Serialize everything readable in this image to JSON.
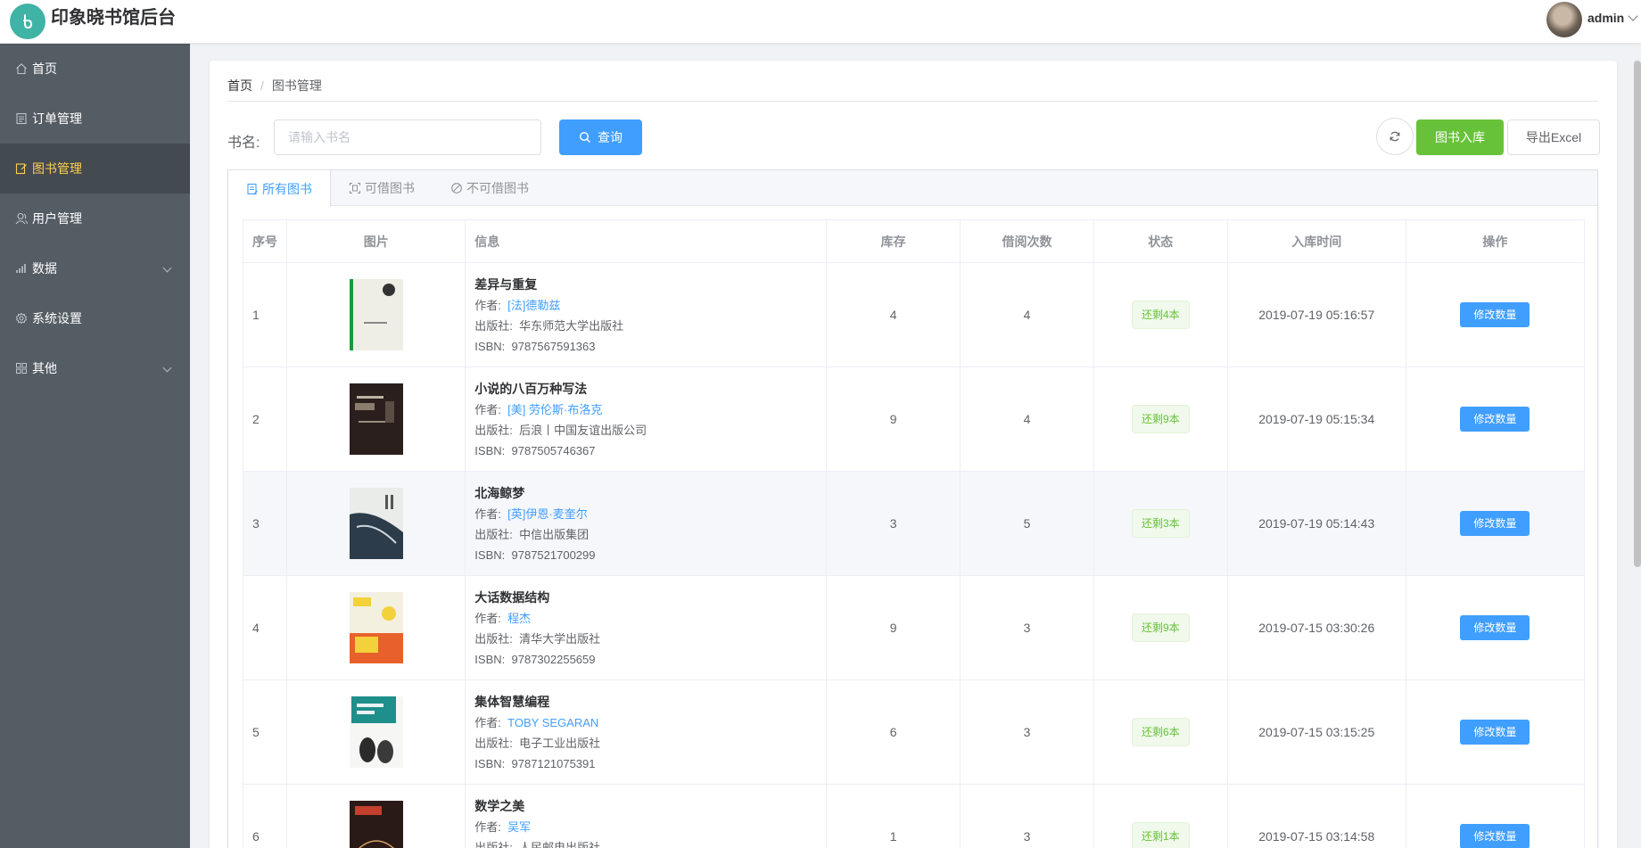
{
  "header": {
    "app_title": "印象晓书馆后台",
    "user_name": "admin"
  },
  "sidebar": {
    "items": [
      {
        "label": "首页",
        "icon": "home-icon"
      },
      {
        "label": "订单管理",
        "icon": "document-icon"
      },
      {
        "label": "图书管理",
        "icon": "edit-icon",
        "active": true
      },
      {
        "label": "用户管理",
        "icon": "user-icon"
      },
      {
        "label": "数据",
        "icon": "chart-icon",
        "expandable": true
      },
      {
        "label": "系统设置",
        "icon": "gear-icon"
      },
      {
        "label": "其他",
        "icon": "grid-icon",
        "expandable": true
      }
    ]
  },
  "breadcrumb": {
    "home": "首页",
    "current": "图书管理"
  },
  "search": {
    "label": "书名:",
    "placeholder": "请输入书名",
    "query_label": "查询"
  },
  "toolbar": {
    "stock_label": "图书入库",
    "export_label": "导出Excel"
  },
  "tabs": [
    {
      "label": "所有图书",
      "active": true
    },
    {
      "label": "可借图书"
    },
    {
      "label": "不可借图书"
    }
  ],
  "table": {
    "headers": [
      "序号",
      "图片",
      "信息",
      "库存",
      "借阅次数",
      "状态",
      "入库时间",
      "操作"
    ],
    "author_prefix": "作者:",
    "publisher_prefix": "出版社:",
    "isbn_prefix": "ISBN:",
    "action_label": "修改数量",
    "rows": [
      {
        "index": "1",
        "title": "差异与重复",
        "author": "[法]德勒兹",
        "publisher": "华东师范大学出版社",
        "isbn": "9787567591363",
        "stock": "4",
        "borrow_count": "4",
        "status": "还剩4本",
        "time": "2019-07-19 05:16:57"
      },
      {
        "index": "2",
        "title": "小说的八百万种写法",
        "author": "[美] 劳伦斯·布洛克",
        "publisher": "后浪丨中国友谊出版公司",
        "isbn": "9787505746367",
        "stock": "9",
        "borrow_count": "4",
        "status": "还剩9本",
        "time": "2019-07-19 05:15:34"
      },
      {
        "index": "3",
        "title": "北海鲸梦",
        "author": "[英]伊恩·麦奎尔",
        "publisher": "中信出版集团",
        "isbn": "9787521700299",
        "stock": "3",
        "borrow_count": "5",
        "status": "还剩3本",
        "time": "2019-07-19 05:14:43"
      },
      {
        "index": "4",
        "title": "大话数据结构",
        "author": "程杰",
        "publisher": "清华大学出版社",
        "isbn": "9787302255659",
        "stock": "9",
        "borrow_count": "3",
        "status": "还剩9本",
        "time": "2019-07-15 03:30:26"
      },
      {
        "index": "5",
        "title": "集体智慧编程",
        "author": "TOBY SEGARAN",
        "publisher": "电子工业出版社",
        "isbn": "9787121075391",
        "stock": "6",
        "borrow_count": "3",
        "status": "还剩6本",
        "time": "2019-07-15 03:15:25"
      },
      {
        "index": "6",
        "title": "数学之美",
        "author": "吴军",
        "publisher": "人民邮电出版社",
        "isbn": "",
        "stock": "1",
        "borrow_count": "3",
        "status": "还剩1本",
        "time": "2019-07-15 03:14:58"
      }
    ]
  },
  "colors": {
    "primary": "#409eff",
    "success": "#67c23a",
    "sidebar_bg": "#545c64",
    "sidebar_active_text": "#ffd04b",
    "logo": "#3fb3a5"
  }
}
